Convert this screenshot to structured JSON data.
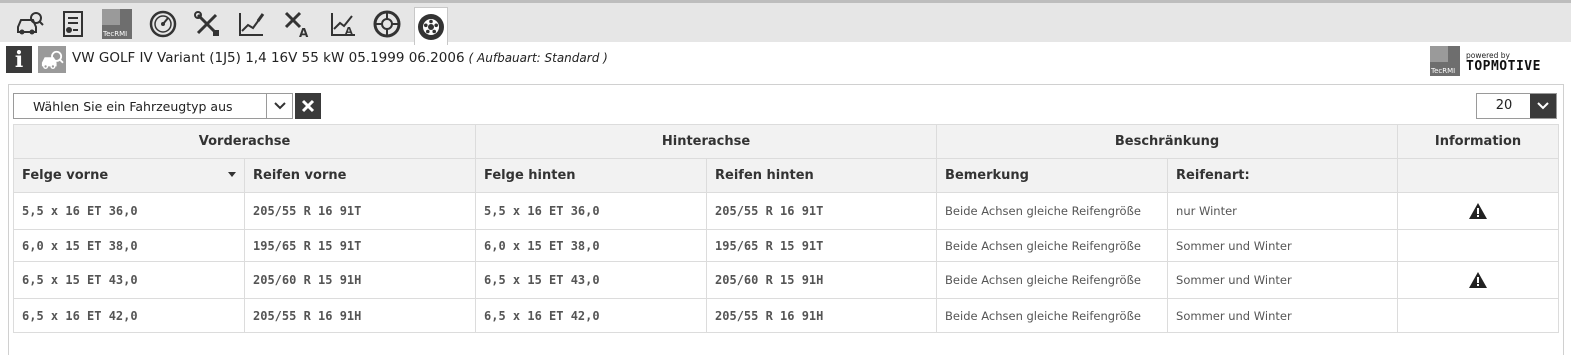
{
  "toolbar": {
    "tools": [
      {
        "icon": "car-search-icon"
      },
      {
        "icon": "document-list-icon"
      },
      {
        "icon": "tecrmi-logo-icon",
        "text": "TecRMI"
      },
      {
        "icon": "gauge-icon"
      },
      {
        "icon": "tools-icon"
      },
      {
        "icon": "service-chart-icon"
      },
      {
        "icon": "tools-a-icon"
      },
      {
        "icon": "service-chart-a-icon"
      },
      {
        "icon": "wheel-icon"
      },
      {
        "icon": "tire-icon",
        "active": true
      }
    ]
  },
  "vehicle": {
    "title": "VW GOLF IV Variant (1J5) 1,4 16V 55 kW 05.1999 06.2006",
    "subtitle": "( Aufbauart: Standard )"
  },
  "brand": {
    "tile_text": "TecRMI",
    "powered_by": "powered by",
    "logo": "TOPMOTIVE"
  },
  "filters": {
    "vehicle_type_placeholder": "Wählen Sie ein Fahrzeugtyp aus",
    "page_size": "20"
  },
  "table": {
    "groups": [
      "Vorderachse",
      "Hinterachse",
      "Beschränkung",
      "Information"
    ],
    "columns": [
      "Felge vorne",
      "Reifen vorne",
      "Felge hinten",
      "Reifen hinten",
      "Bemerkung",
      "Reifenart:"
    ],
    "rows": [
      {
        "felge_vorne": "5,5 x 16 ET 36,0",
        "reifen_vorne": "205/55 R 16 91T",
        "felge_hinten": "5,5 x 16 ET 36,0",
        "reifen_hinten": "205/55 R 16 91T",
        "bemerkung": "Beide Achsen gleiche Reifengröße",
        "reifenart": "nur Winter",
        "warning": true
      },
      {
        "felge_vorne": "6,0 x 15 ET 38,0",
        "reifen_vorne": "195/65 R 15 91T",
        "felge_hinten": "6,0 x 15 ET 38,0",
        "reifen_hinten": "195/65 R 15 91T",
        "bemerkung": "Beide Achsen gleiche Reifengröße",
        "reifenart": "Sommer und Winter",
        "warning": false
      },
      {
        "felge_vorne": "6,5 x 15 ET 43,0",
        "reifen_vorne": "205/60 R 15 91H",
        "felge_hinten": "6,5 x 15 ET 43,0",
        "reifen_hinten": "205/60 R 15 91H",
        "bemerkung": "Beide Achsen gleiche Reifengröße",
        "reifenart": "Sommer und Winter",
        "warning": true
      },
      {
        "felge_vorne": "6,5 x 16 ET 42,0",
        "reifen_vorne": "205/55 R 16 91H",
        "felge_hinten": "6,5 x 16 ET 42,0",
        "reifen_hinten": "205/55 R 16 91H",
        "bemerkung": "Beide Achsen gleiche Reifengröße",
        "reifenart": "Sommer und Winter",
        "warning": false
      }
    ]
  }
}
